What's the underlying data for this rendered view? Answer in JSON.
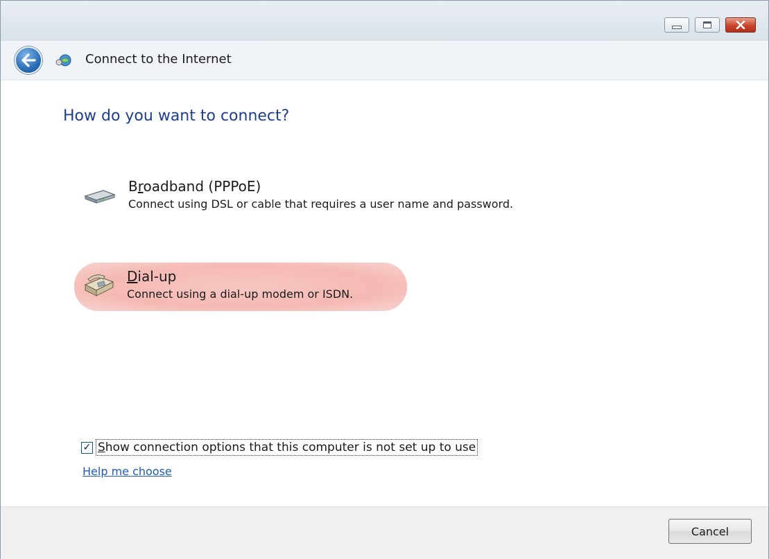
{
  "window": {
    "title": "Connect to the Internet",
    "caption_buttons": [
      "minimize-button",
      "maximize-button",
      "close-button"
    ]
  },
  "main": {
    "question": "How do you want to connect?",
    "options": [
      {
        "title_before": "B",
        "title_underlined": "r",
        "title_after": "oadband (PPPoE)",
        "description": "Connect using DSL or cable that requires a user name and password.",
        "icon": "modem-icon",
        "highlighted": false
      },
      {
        "title_before": "",
        "title_underlined": "D",
        "title_after": "ial-up",
        "description": "Connect using a dial-up modem or ISDN.",
        "icon": "telephone-icon",
        "highlighted": true,
        "highlight_color": "#f5b9b3"
      }
    ],
    "show_options_checkbox": {
      "checked": true,
      "check_glyph": "✓",
      "label_underlined": "S",
      "label_rest": "how connection options that this computer is not set up to use"
    },
    "help_link": "Help me choose"
  },
  "footer": {
    "cancel_label": "Cancel"
  },
  "colors": {
    "heading": "#1e3d8c",
    "link": "#1d5bb8",
    "highlight": "#f5b9b3",
    "footer_bg": "#f0f0f0"
  }
}
